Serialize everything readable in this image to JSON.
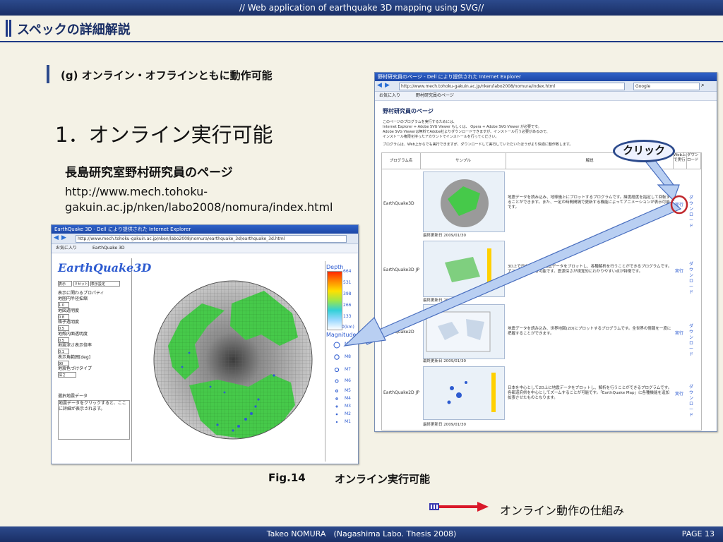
{
  "top_bar": {
    "title": "// Web application of earthquake 3D mapping using SVG//"
  },
  "heading": {
    "title": "スペックの詳細解説"
  },
  "section": {
    "label": "(g) オンライン・オフラインともに動作可能"
  },
  "main": {
    "title": "1．オンライン実行可能",
    "page_name": "長島研究室野村研究員のページ",
    "url_line1": "http://www.mech.tohoku-",
    "url_line2": "gakuin.ac.jp/nken/labo2008/nomura/index.html"
  },
  "left_window": {
    "title": "EarthQuake 3D - Dell により提供された Internet Explorer",
    "address": "http://www.mech.tohoku-gakuin.ac.jp/nken/labo2008/nomura/earthquake_3d/earthquake_3d.html",
    "tab_fav": "お気に入り",
    "tab_page": "EarthQuake 3D",
    "logo": "EarthQuake3D",
    "buttons": [
      "表示",
      "リセット",
      "表示設定"
    ],
    "props": [
      "表示に関わるプロパティ",
      "地圏円半径拡縮",
      "地図透明度",
      "格子透明度",
      "地殻内面透明度",
      "地震深さ表示倍率",
      "表示角範囲[deg]",
      "地震色づけタイプ"
    ],
    "values": [
      "1.0",
      "0.8",
      "0.5",
      "0.5",
      "0.1",
      "1.0",
      "90",
      "深さ"
    ],
    "select_label": "選択地震データ",
    "select_hint": "地震データをクリックすると、ここに詳細が表示されます。",
    "depth_label": "Depth",
    "depth_unit": "0(km)",
    "depth_values": [
      "664",
      "531",
      "398",
      "266",
      "133"
    ],
    "magnitude_label": "Magnitude",
    "magnitude_values": [
      "M9",
      "M8",
      "M7",
      "M6",
      "M5",
      "M4",
      "M3",
      "M2",
      "M1"
    ]
  },
  "right_window": {
    "title": "野村研究員のページ - Dell により提供された Internet Explorer",
    "address": "http://www.mech.tohoku-gakuin.ac.jp/nken/labo2008/nomura/index.html",
    "search": "Google",
    "tab_fav": "お気に入り",
    "tab_page": "野村研究員のページ",
    "page_heading": "野村研究員のページ",
    "intro1": "このページのプログラムを実行するためには、",
    "intro2": "Internet Explorer + Adobe SVG Viewer もしくは、 Opera + Adobe SVG Viewer が必要です。",
    "intro3": "Adobe SVG Viewerは無料でAdobe社よりダウンロードできますが、インストール行う必要があるので、",
    "intro4": "インストール権限を持ったアカウントでインストールを行ってください。",
    "intro5": "プログラムは、Web上からでも実行できますが、ダウンロードして実行していただいたほうがより快適に動作致します。",
    "headers": [
      "プログラム名",
      "サンプル",
      "解説",
      "Web上で実行",
      "ダウンロード"
    ],
    "rows": [
      {
        "name": "EarthQuake3D",
        "desc": "地震データを読み込み、地球儀上にプロットするプログラムです。緯度経度を指定して回転することができます。また、一定の時間間隔で更新する機能によってアニメーションが表示可能です。",
        "updated": "最終更新日 2009/01/30",
        "exec": "実行",
        "dl": "ダウンロード"
      },
      {
        "name": "EarthQuake3D JP",
        "desc": "3D上で日本を中心に地震データをプロットし、各種解析を行うことができるプログラムです。アニメーションも可能です。震源深さが視覚的にわかりやすい点が特徴です。",
        "updated": "最終更新日 2009/01/30",
        "exec": "実行",
        "dl": "ダウンロード"
      },
      {
        "name": "EarthQuake2D",
        "desc": "地震データを読み込み、世界地図(2D)にプロットするプログラムです。全世界の情報を一度に把握することができます。",
        "updated": "最終更新日 2009/01/30",
        "exec": "実行",
        "dl": "ダウンロード"
      },
      {
        "name": "EarthQuake2D JP",
        "desc": "日本を中心として2D上に地震データをプロットし、解析を行うことができるプログラムです。各都道府県を中心としてズームすることが可能です。「EarthQuake Map」に各種機能を追加拡張させたものとなります。",
        "updated": "最終更新日 2009/01/30",
        "exec": "実行",
        "dl": "ダウンロード"
      }
    ]
  },
  "callout": {
    "click": "クリック"
  },
  "caption": {
    "fig": "Fig.14",
    "text": "オンライン実行可能"
  },
  "mechanism": {
    "text": "オンライン動作の仕組み"
  },
  "footer": {
    "center": "Takeo NOMURA　(Nagashima Labo. Thesis 2008)",
    "page": "PAGE 13"
  },
  "colors": {
    "accent": "#1f3a86",
    "background": "#f4f2e6",
    "link": "#2d5bd0",
    "land": "#3fbf3f"
  }
}
